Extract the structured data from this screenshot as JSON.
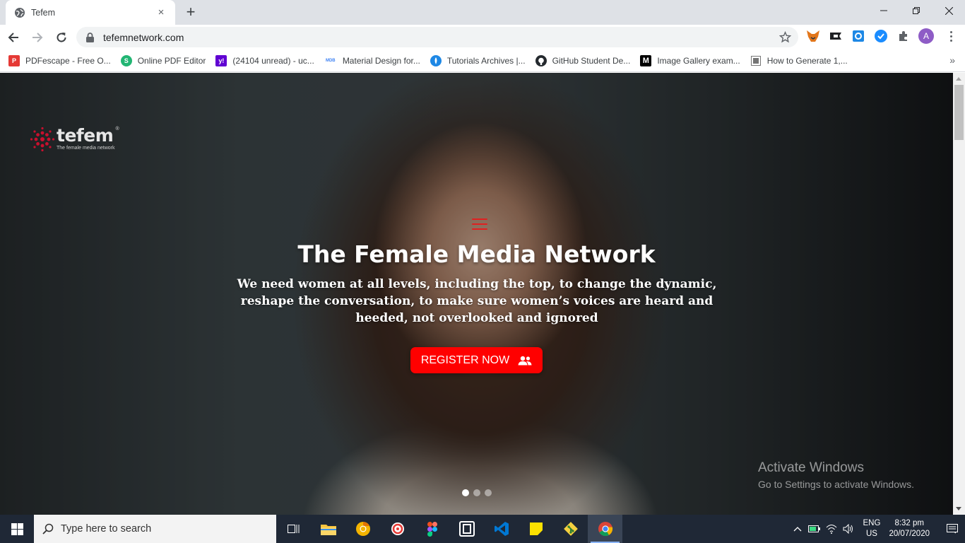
{
  "browser": {
    "tab": {
      "title": "Tefem",
      "favicon": "globe-icon",
      "close": "×"
    },
    "new_tab": "+",
    "window_controls": {
      "minimize": "—",
      "maximize": "❐",
      "close": "✕"
    },
    "url": "tefemnetwork.com",
    "profile_initial": "A",
    "extensions": [
      "metamask-fox-icon",
      "ticket-icon",
      "blue-square-icon",
      "check-badge-icon",
      "puzzle-icon"
    ]
  },
  "bookmarks": [
    {
      "label": "PDFescape - Free O...",
      "icon_text": "P",
      "color": "#e53935"
    },
    {
      "label": "Online PDF Editor",
      "icon_text": "S",
      "color": "#22b573"
    },
    {
      "label": "(24104 unread) - uc...",
      "icon_text": "y!",
      "color": "#6001d2"
    },
    {
      "label": "Material Design for...",
      "icon_text": "MDB",
      "color": "#4285f4"
    },
    {
      "label": "Tutorials Archives |...",
      "icon_text": "",
      "color": "#1e88e5"
    },
    {
      "label": "GitHub Student De...",
      "icon_text": "",
      "color": "#24292e"
    },
    {
      "label": "Image Gallery exam...",
      "icon_text": "M",
      "color": "#000000"
    },
    {
      "label": "How to Generate 1,...",
      "icon_text": "",
      "color": "#757575"
    }
  ],
  "bookmarks_more": "»",
  "page": {
    "logo": {
      "word": "tefem",
      "tagline": "The female media network",
      "reg": "®"
    },
    "hero_title": "The Female Media Network",
    "hero_text": "We need women at all levels, including the top, to change the dynamic, reshape the conversation, to make sure women’s voices are heard and heeded, not overlooked and ignored",
    "register_label": "REGISTER NOW",
    "carousel_active_index": 0,
    "carousel_count": 3,
    "accent_color": "#ff0000"
  },
  "watermark": {
    "title": "Activate Windows",
    "subtitle": "Go to Settings to activate Windows."
  },
  "taskbar": {
    "search_placeholder": "Type here to search",
    "apps": [
      "task-view-icon",
      "file-explorer-icon",
      "chrome-canary-icon",
      "app-red-circle-icon",
      "figma-icon",
      "app-square-icon",
      "vscode-icon",
      "sticky-notes-icon",
      "git-icon",
      "chrome-icon"
    ],
    "lang_line1": "ENG",
    "lang_line2": "US",
    "time": "8:32 pm",
    "date": "20/07/2020"
  }
}
